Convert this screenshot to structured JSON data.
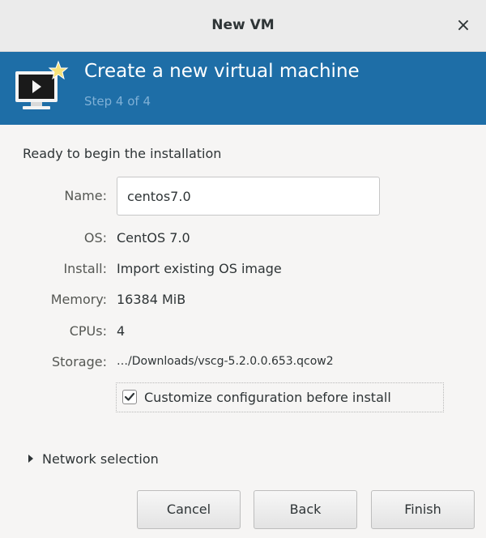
{
  "window": {
    "title": "New VM",
    "close_glyph": "×"
  },
  "banner": {
    "icon": "vm-monitor-icon",
    "title": "Create a new virtual machine",
    "step": "Step 4 of 4"
  },
  "summary": {
    "heading": "Ready to begin the installation",
    "name_label": "Name:",
    "name_value": "centos7.0",
    "os_label": "OS:",
    "os_value": "CentOS 7.0",
    "install_label": "Install:",
    "install_value": "Import existing OS image",
    "memory_label": "Memory:",
    "memory_value": "16384 MiB",
    "cpus_label": "CPUs:",
    "cpus_value": "4",
    "storage_label": "Storage:",
    "storage_value": "…/Downloads/vscg-5.2.0.0.653.qcow2"
  },
  "customize": {
    "label": "Customize configuration before install",
    "checked": true
  },
  "network": {
    "label": "Network selection",
    "expanded": false
  },
  "buttons": {
    "cancel": "Cancel",
    "back": "Back",
    "finish": "Finish"
  },
  "colors": {
    "banner": "#1e6ea7",
    "step_text": "#7fb0d6"
  }
}
